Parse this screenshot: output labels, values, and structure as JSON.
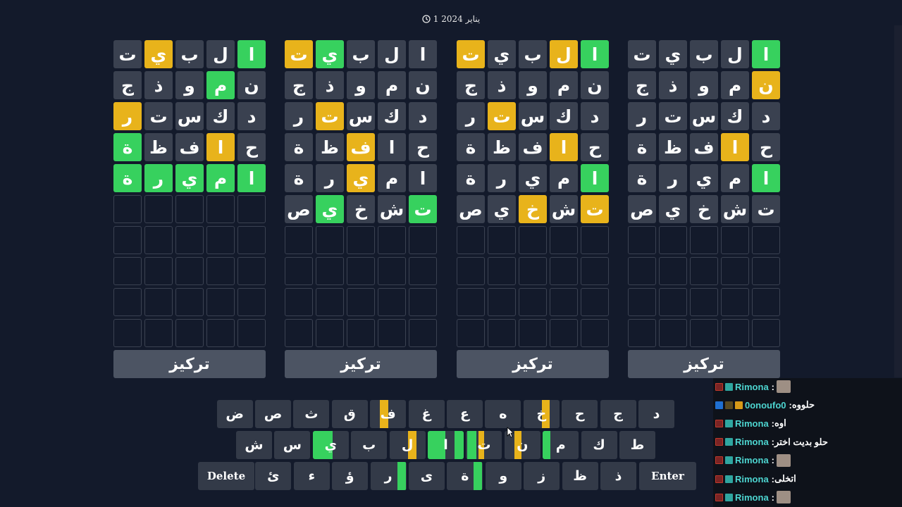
{
  "date": "1 يناير 2024",
  "focus_label": "تركيز",
  "boards": [
    {
      "rows": [
        [
          [
            "ا",
            "g"
          ],
          [
            "ل",
            "f"
          ],
          [
            "ب",
            "f"
          ],
          [
            "ي",
            "f"
          ],
          [
            "ت",
            "f"
          ]
        ],
        [
          [
            "ن",
            "y"
          ],
          [
            "م",
            "f"
          ],
          [
            "و",
            "f"
          ],
          [
            "ذ",
            "f"
          ],
          [
            "ج",
            "f"
          ]
        ],
        [
          [
            "د",
            "f"
          ],
          [
            "ك",
            "f"
          ],
          [
            "س",
            "f"
          ],
          [
            "ت",
            "f"
          ],
          [
            "ر",
            "f"
          ]
        ],
        [
          [
            "ح",
            "f"
          ],
          [
            "ا",
            "y"
          ],
          [
            "ف",
            "f"
          ],
          [
            "ظ",
            "f"
          ],
          [
            "ة",
            "f"
          ]
        ],
        [
          [
            "ا",
            "g"
          ],
          [
            "م",
            "f"
          ],
          [
            "ي",
            "f"
          ],
          [
            "ر",
            "f"
          ],
          [
            "ة",
            "f"
          ]
        ],
        [
          [
            "ت",
            "f"
          ],
          [
            "ش",
            "f"
          ],
          [
            "خ",
            "f"
          ],
          [
            "ي",
            "f"
          ],
          [
            "ص",
            "f"
          ]
        ]
      ]
    },
    {
      "rows": [
        [
          [
            "ا",
            "g"
          ],
          [
            "ل",
            "y"
          ],
          [
            "ب",
            "f"
          ],
          [
            "ي",
            "f"
          ],
          [
            "ت",
            "y"
          ]
        ],
        [
          [
            "ن",
            "f"
          ],
          [
            "م",
            "f"
          ],
          [
            "و",
            "f"
          ],
          [
            "ذ",
            "f"
          ],
          [
            "ج",
            "f"
          ]
        ],
        [
          [
            "د",
            "f"
          ],
          [
            "ك",
            "f"
          ],
          [
            "س",
            "f"
          ],
          [
            "ت",
            "y"
          ],
          [
            "ر",
            "f"
          ]
        ],
        [
          [
            "ح",
            "f"
          ],
          [
            "ا",
            "y"
          ],
          [
            "ف",
            "f"
          ],
          [
            "ظ",
            "f"
          ],
          [
            "ة",
            "f"
          ]
        ],
        [
          [
            "ا",
            "g"
          ],
          [
            "م",
            "f"
          ],
          [
            "ي",
            "f"
          ],
          [
            "ر",
            "f"
          ],
          [
            "ة",
            "f"
          ]
        ],
        [
          [
            "ت",
            "y"
          ],
          [
            "ش",
            "f"
          ],
          [
            "خ",
            "y"
          ],
          [
            "ي",
            "f"
          ],
          [
            "ص",
            "f"
          ]
        ]
      ]
    },
    {
      "rows": [
        [
          [
            "ا",
            "f"
          ],
          [
            "ل",
            "f"
          ],
          [
            "ب",
            "f"
          ],
          [
            "ي",
            "g"
          ],
          [
            "ت",
            "y"
          ]
        ],
        [
          [
            "ن",
            "f"
          ],
          [
            "م",
            "f"
          ],
          [
            "و",
            "f"
          ],
          [
            "ذ",
            "f"
          ],
          [
            "ج",
            "f"
          ]
        ],
        [
          [
            "د",
            "f"
          ],
          [
            "ك",
            "f"
          ],
          [
            "س",
            "f"
          ],
          [
            "ت",
            "y"
          ],
          [
            "ر",
            "f"
          ]
        ],
        [
          [
            "ح",
            "f"
          ],
          [
            "ا",
            "f"
          ],
          [
            "ف",
            "y"
          ],
          [
            "ظ",
            "f"
          ],
          [
            "ة",
            "f"
          ]
        ],
        [
          [
            "ا",
            "f"
          ],
          [
            "م",
            "f"
          ],
          [
            "ي",
            "y"
          ],
          [
            "ر",
            "f"
          ],
          [
            "ة",
            "f"
          ]
        ],
        [
          [
            "ت",
            "g"
          ],
          [
            "ش",
            "f"
          ],
          [
            "خ",
            "f"
          ],
          [
            "ي",
            "g"
          ],
          [
            "ص",
            "f"
          ]
        ]
      ]
    },
    {
      "rows": [
        [
          [
            "ا",
            "g"
          ],
          [
            "ل",
            "f"
          ],
          [
            "ب",
            "f"
          ],
          [
            "ي",
            "y"
          ],
          [
            "ت",
            "f"
          ]
        ],
        [
          [
            "ن",
            "f"
          ],
          [
            "م",
            "g"
          ],
          [
            "و",
            "f"
          ],
          [
            "ذ",
            "f"
          ],
          [
            "ج",
            "f"
          ]
        ],
        [
          [
            "د",
            "f"
          ],
          [
            "ك",
            "f"
          ],
          [
            "س",
            "f"
          ],
          [
            "ت",
            "f"
          ],
          [
            "ر",
            "y"
          ]
        ],
        [
          [
            "ح",
            "f"
          ],
          [
            "ا",
            "y"
          ],
          [
            "ف",
            "f"
          ],
          [
            "ظ",
            "f"
          ],
          [
            "ة",
            "g"
          ]
        ],
        [
          [
            "ا",
            "g"
          ],
          [
            "م",
            "g"
          ],
          [
            "ي",
            "g"
          ],
          [
            "ر",
            "g"
          ],
          [
            "ة",
            "g"
          ]
        ]
      ]
    }
  ],
  "keyboard": {
    "delete_label": "Delete",
    "enter_label": "Enter",
    "row1": [
      {
        "k": "د",
        "s": []
      },
      {
        "k": "ج",
        "s": []
      },
      {
        "k": "ح",
        "s": []
      },
      {
        "k": "خ",
        "s": [
          [
            "y",
            26,
            11
          ]
        ]
      },
      {
        "k": "ه",
        "s": []
      },
      {
        "k": "ع",
        "s": []
      },
      {
        "k": "غ",
        "s": []
      },
      {
        "k": "ف",
        "s": [
          [
            "y",
            14,
            12
          ]
        ]
      },
      {
        "k": "ق",
        "s": []
      },
      {
        "k": "ث",
        "s": []
      },
      {
        "k": "ص",
        "s": []
      },
      {
        "k": "ض",
        "s": []
      }
    ],
    "row2": [
      {
        "k": "ط",
        "s": []
      },
      {
        "k": "ك",
        "s": []
      },
      {
        "k": "م",
        "s": [
          [
            "g",
            0,
            11
          ]
        ]
      },
      {
        "k": "ن",
        "s": [
          [
            "y",
            14,
            10
          ]
        ]
      },
      {
        "k": "ت",
        "s": [
          [
            "y",
            18,
            8
          ],
          [
            "g",
            2,
            13
          ]
        ]
      },
      {
        "k": "ا",
        "s": [
          [
            "g",
            0,
            25
          ],
          [
            "g",
            38,
            14
          ]
        ]
      },
      {
        "k": "ل",
        "s": [
          [
            "y",
            26,
            12
          ]
        ]
      },
      {
        "k": "ب",
        "s": []
      },
      {
        "k": "ي",
        "s": [
          [
            "g",
            0,
            28
          ]
        ]
      },
      {
        "k": "س",
        "s": []
      },
      {
        "k": "ش",
        "s": []
      }
    ],
    "row3": [
      {
        "k": "ذ",
        "s": []
      },
      {
        "k": "ظ",
        "s": []
      },
      {
        "k": "ز",
        "s": []
      },
      {
        "k": "و",
        "s": []
      },
      {
        "k": "ة",
        "s": [
          [
            "g",
            38,
            12
          ]
        ]
      },
      {
        "k": "ى",
        "s": []
      },
      {
        "k": "ر",
        "s": [
          [
            "g",
            38,
            12
          ]
        ]
      },
      {
        "k": "ؤ",
        "s": []
      },
      {
        "k": "ء",
        "s": []
      },
      {
        "k": "ئ",
        "s": []
      }
    ]
  },
  "chat": [
    {
      "user": "Rimona",
      "text": "",
      "emote": true,
      "badges": [
        "b-red",
        "b-sq"
      ]
    },
    {
      "user": "0onoufo0",
      "text": "حلووه",
      "emote": false,
      "badges": [
        "b-blue",
        "b-lvl",
        "b-crown"
      ]
    },
    {
      "user": "Rimona",
      "text": "اوه",
      "emote": false,
      "badges": [
        "b-red",
        "b-sq"
      ]
    },
    {
      "user": "Rimona",
      "text": "حلو بديت اختر",
      "emote": false,
      "badges": [
        "b-red",
        "b-sq"
      ]
    },
    {
      "user": "Rimona",
      "text": "",
      "emote": true,
      "badges": [
        "b-red",
        "b-sq"
      ]
    },
    {
      "user": "Rimona",
      "text": "اتخلى",
      "emote": false,
      "badges": [
        "b-red",
        "b-sq"
      ]
    },
    {
      "user": "Rimona",
      "text": "",
      "emote": true,
      "badges": [
        "b-red",
        "b-sq"
      ]
    }
  ]
}
